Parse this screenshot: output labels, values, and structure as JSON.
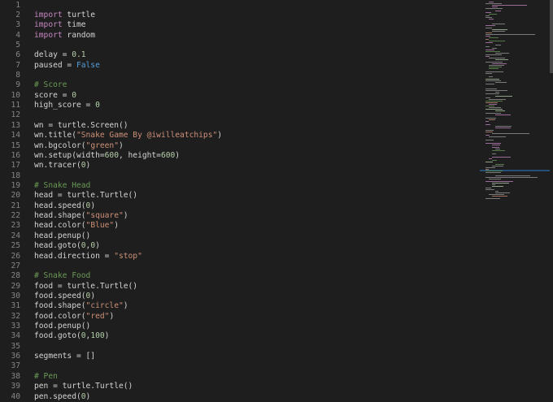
{
  "colors": {
    "kw": "#c586c0",
    "str": "#ce9178",
    "num": "#b5cea8",
    "com": "#6a9955",
    "const": "#569cd6",
    "text": "#d4d4d4"
  },
  "lines": [
    [],
    [
      [
        "kw",
        "import"
      ],
      [
        "t",
        " turtle"
      ]
    ],
    [
      [
        "kw",
        "import"
      ],
      [
        "t",
        " time"
      ]
    ],
    [
      [
        "kw",
        "import"
      ],
      [
        "t",
        " random"
      ]
    ],
    [],
    [
      [
        "t",
        "delay = "
      ],
      [
        "num",
        "0.1"
      ]
    ],
    [
      [
        "t",
        "paused = "
      ],
      [
        "const",
        "False"
      ]
    ],
    [],
    [
      [
        "com",
        "# Score"
      ]
    ],
    [
      [
        "t",
        "score = "
      ],
      [
        "num",
        "0"
      ]
    ],
    [
      [
        "t",
        "high_score = "
      ],
      [
        "num",
        "0"
      ]
    ],
    [],
    [
      [
        "t",
        "wn = turtle.Screen()"
      ]
    ],
    [
      [
        "t",
        "wn.title("
      ],
      [
        "str",
        "\"Snake Game By @iwilleatchips\""
      ],
      [
        "t",
        ")"
      ]
    ],
    [
      [
        "t",
        "wn.bgcolor("
      ],
      [
        "str",
        "\"green\""
      ],
      [
        "t",
        ")"
      ]
    ],
    [
      [
        "t",
        "wn.setup(width="
      ],
      [
        "num",
        "600"
      ],
      [
        "t",
        ", height="
      ],
      [
        "num",
        "600"
      ],
      [
        "t",
        ")"
      ]
    ],
    [
      [
        "t",
        "wn.tracer("
      ],
      [
        "num",
        "0"
      ],
      [
        "t",
        ")"
      ]
    ],
    [],
    [
      [
        "com",
        "# Snake Head"
      ]
    ],
    [
      [
        "t",
        "head = turtle.Turtle()"
      ]
    ],
    [
      [
        "t",
        "head.speed("
      ],
      [
        "num",
        "0"
      ],
      [
        "t",
        ")"
      ]
    ],
    [
      [
        "t",
        "head.shape("
      ],
      [
        "str",
        "\"square\""
      ],
      [
        "t",
        ")"
      ]
    ],
    [
      [
        "t",
        "head.color("
      ],
      [
        "str",
        "\"Blue\""
      ],
      [
        "t",
        ")"
      ]
    ],
    [
      [
        "t",
        "head.penup()"
      ]
    ],
    [
      [
        "t",
        "head.goto("
      ],
      [
        "num",
        "0"
      ],
      [
        "t",
        ","
      ],
      [
        "num",
        "0"
      ],
      [
        "t",
        ")"
      ]
    ],
    [
      [
        "t",
        "head.direction = "
      ],
      [
        "str",
        "\"stop\""
      ]
    ],
    [],
    [
      [
        "com",
        "# Snake Food"
      ]
    ],
    [
      [
        "t",
        "food = turtle.Turtle()"
      ]
    ],
    [
      [
        "t",
        "food.speed("
      ],
      [
        "num",
        "0"
      ],
      [
        "t",
        ")"
      ]
    ],
    [
      [
        "t",
        "food.shape("
      ],
      [
        "str",
        "\"circle\""
      ],
      [
        "t",
        ")"
      ]
    ],
    [
      [
        "t",
        "food.color("
      ],
      [
        "str",
        "\"red\""
      ],
      [
        "t",
        ")"
      ]
    ],
    [
      [
        "t",
        "food.penup()"
      ]
    ],
    [
      [
        "t",
        "food.goto("
      ],
      [
        "num",
        "0"
      ],
      [
        "t",
        ","
      ],
      [
        "num",
        "100"
      ],
      [
        "t",
        ")"
      ]
    ],
    [],
    [
      [
        "t",
        "segments = []"
      ]
    ],
    [],
    [
      [
        "com",
        "# Pen"
      ]
    ],
    [
      [
        "t",
        "pen = turtle.Turtle()"
      ]
    ],
    [
      [
        "t",
        "pen.speed("
      ],
      [
        "num",
        "0"
      ],
      [
        "t",
        ")"
      ]
    ]
  ]
}
